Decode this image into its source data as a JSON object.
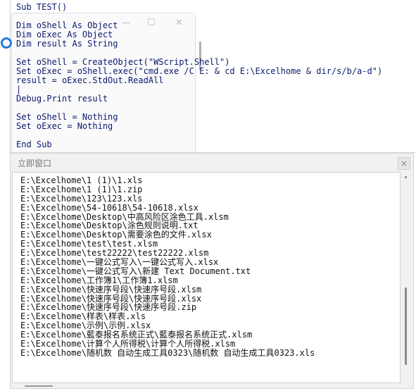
{
  "code_window": {
    "lines": [
      "Sub TEST()",
      "",
      "Dim oShell As Object",
      "Dim oExec As Object",
      "Dim result As String",
      "",
      "Set oShell = CreateObject(\"WScript.Shell\")",
      "Set oExec = oShell.exec(\"cmd.exe /C E: & cd E:\\Excelhome & dir/s/b/a-d\")",
      "result = oExec.StdOut.ReadAll",
      "|",
      "Debug.Print result",
      "",
      "Set oShell = Nothing",
      "Set oExec = Nothing",
      "",
      "End Sub"
    ],
    "ghost_minimize": "—",
    "ghost_maximize": "☐",
    "ghost_close": "✕"
  },
  "immediate_window": {
    "title": "立即窗口",
    "close": "×",
    "lines": [
      "E:\\Excelhome\\1 (1)\\1.xls",
      "E:\\Excelhome\\1 (1)\\1.zip",
      "E:\\Excelhome\\123\\123.xls",
      "E:\\Excelhome\\54-10618\\54-10618.xlsx",
      "E:\\Excelhome\\Desktop\\中高风险区涂色工具.xlsm",
      "E:\\Excelhome\\Desktop\\涂色规则说明.txt",
      "E:\\Excelhome\\Desktop\\需要涂色的文件.xlsx",
      "E:\\Excelhome\\test\\test.xlsm",
      "E:\\Excelhome\\test22222\\test22222.xlsm",
      "E:\\Excelhome\\一键公式写入\\一键公式写入.xlsx",
      "E:\\Excelhome\\一键公式写入\\新建 Text Document.txt",
      "E:\\Excelhome\\工作簿1\\工作簿1.xlsm",
      "E:\\Excelhome\\快速序号段\\快速序号段.xlsm",
      "E:\\Excelhome\\快速序号段\\快速序号段.xlsx",
      "E:\\Excelhome\\快速序号段\\快速序号段.zip",
      "E:\\Excelhome\\样表\\样表.xls",
      "E:\\Excelhome\\示例\\示例.xlsx",
      "E:\\Excelhome\\藍泰报名系统正式\\藍泰报名系统正式.xlsm",
      "E:\\Excelhome\\计算个人所得税\\计算个人所得税.xlsm",
      "E:\\Excelhome\\随机数 自动生成工具0323\\随机数 自动生成工具0323.xls"
    ]
  }
}
